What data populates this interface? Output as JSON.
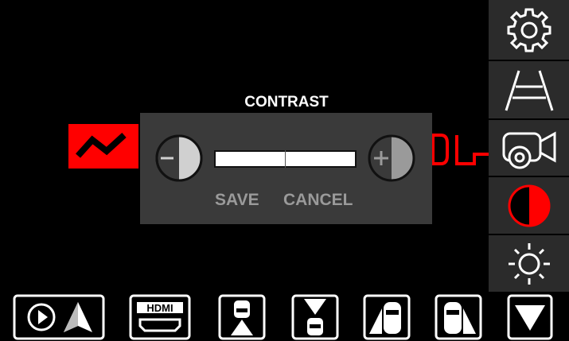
{
  "dialog": {
    "title": "CONTRAST",
    "save_label": "SAVE",
    "cancel_label": "CANCEL",
    "contrast_level": 0.5
  },
  "sidebar": {
    "items": [
      {
        "icon": "gear-icon"
      },
      {
        "icon": "parking-guidelines-icon"
      },
      {
        "icon": "camera-settings-icon"
      },
      {
        "icon": "contrast-icon",
        "active": true
      },
      {
        "icon": "brightness-icon"
      }
    ]
  },
  "bottom_bar": {
    "items": [
      {
        "icon": "carplay-android-auto-icon"
      },
      {
        "icon": "hdmi-icon",
        "label": "HDMI"
      },
      {
        "icon": "front-camera-view-icon"
      },
      {
        "icon": "rear-camera-view-icon"
      },
      {
        "icon": "left-side-camera-icon"
      },
      {
        "icon": "right-side-camera-icon"
      },
      {
        "icon": "down-arrow-icon"
      }
    ]
  },
  "colors": {
    "accent": "#ff0000",
    "dialog_bg": "#3a3a3a",
    "sidebar_bg": "#2b2b2b",
    "button_text": "#9a9a9a"
  }
}
